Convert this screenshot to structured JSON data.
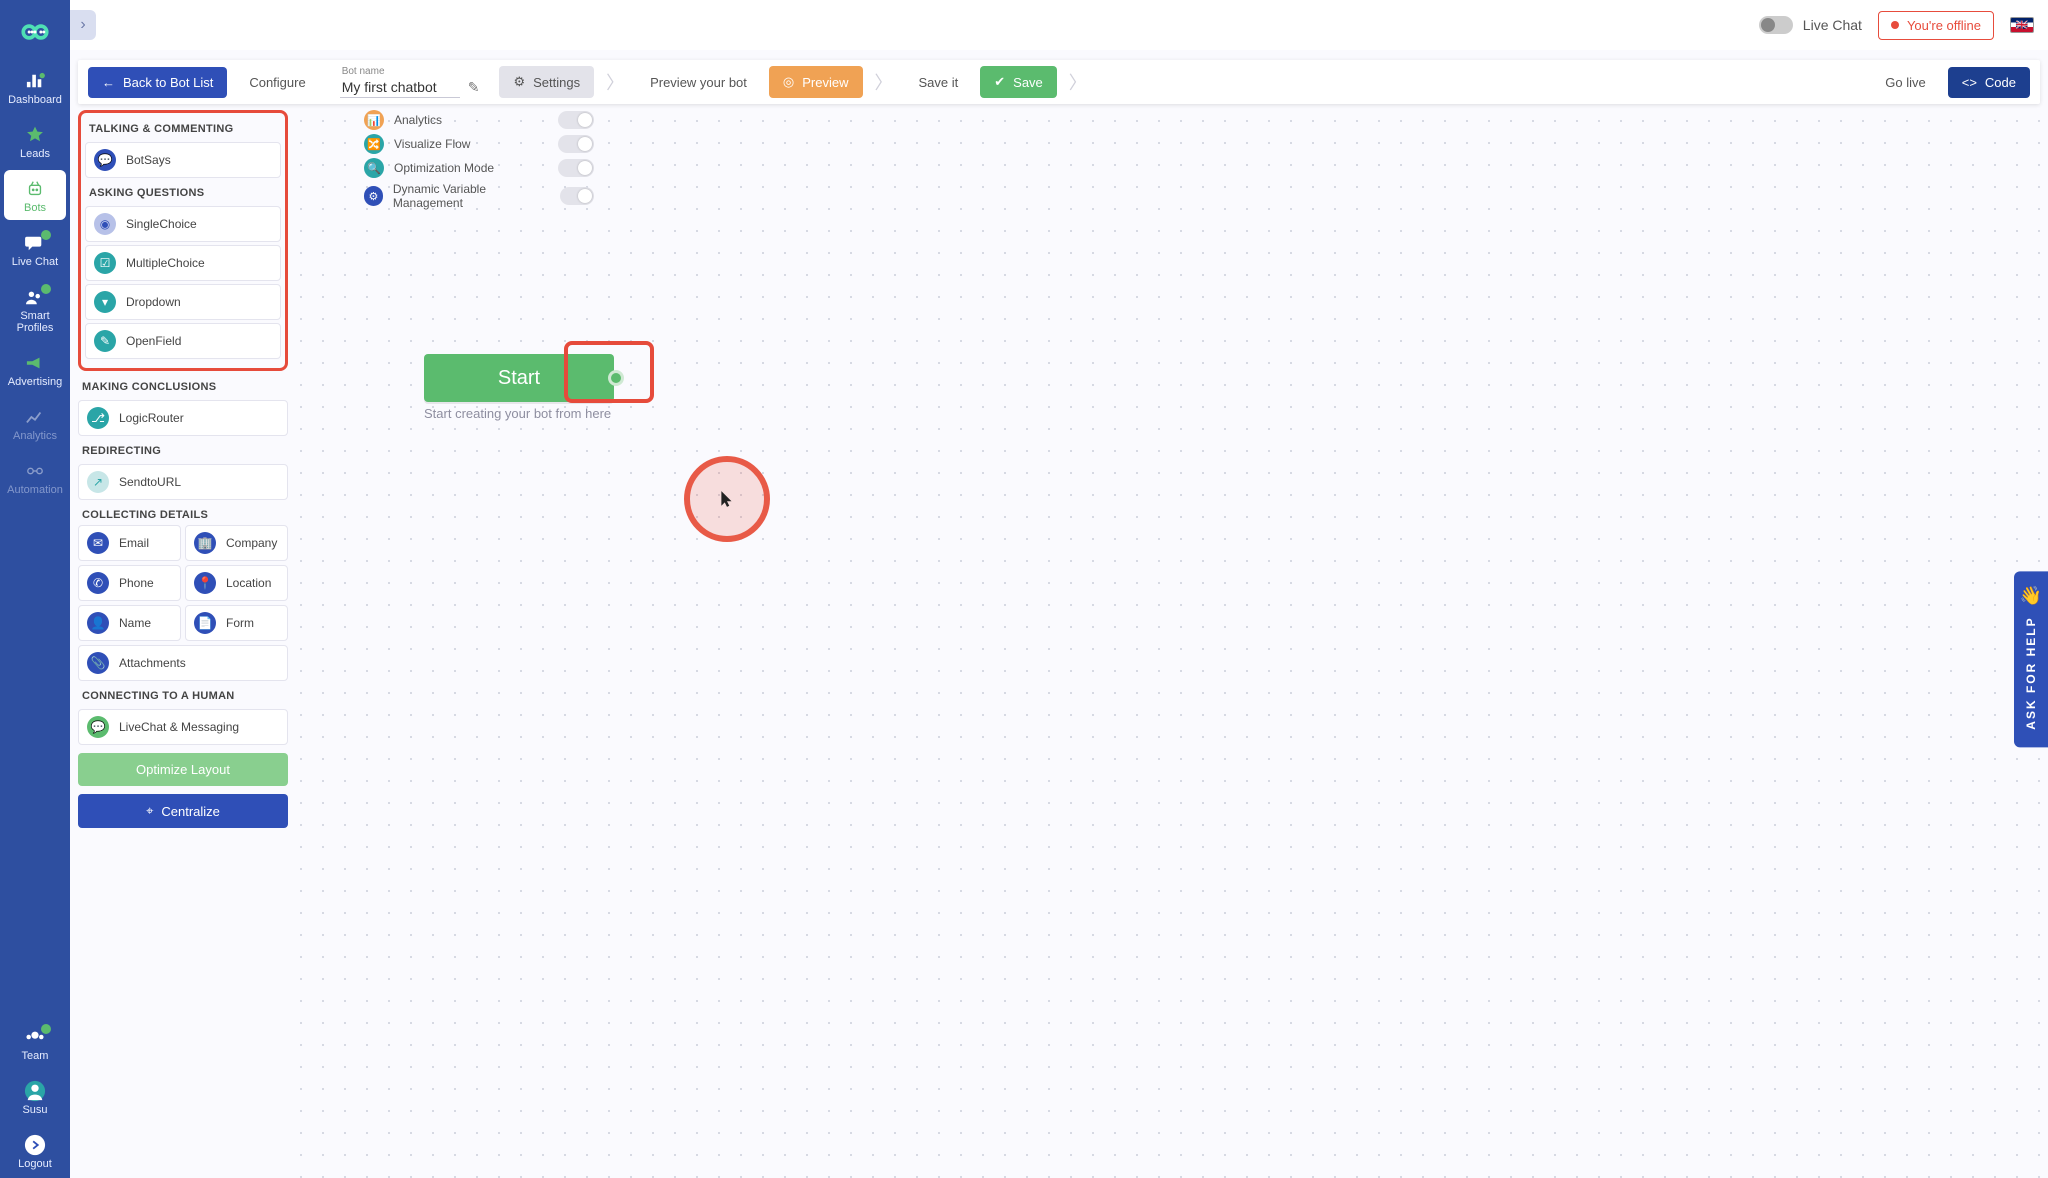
{
  "topbar": {
    "livechat_label": "Live Chat",
    "offline_label": "You're offline"
  },
  "toolbar": {
    "back_label": "Back to Bot List",
    "configure_label": "Configure",
    "botname_caption": "Bot name",
    "botname_value": "My first chatbot",
    "settings_label": "Settings",
    "preview_bot_label": "Preview your bot",
    "preview_btn": "Preview",
    "saveit_label": "Save it",
    "save_btn": "Save",
    "golive_label": "Go live",
    "code_btn": "Code"
  },
  "leftnav": [
    {
      "id": "dashboard",
      "label": "Dashboard"
    },
    {
      "id": "leads",
      "label": "Leads"
    },
    {
      "id": "bots",
      "label": "Bots"
    },
    {
      "id": "livechat",
      "label": "Live Chat"
    },
    {
      "id": "smartprofiles",
      "label": "Smart Profiles"
    },
    {
      "id": "advertising",
      "label": "Advertising"
    },
    {
      "id": "analytics",
      "label": "Analytics"
    },
    {
      "id": "automation",
      "label": "Automation"
    },
    {
      "id": "team",
      "label": "Team"
    },
    {
      "id": "user",
      "label": "Susu"
    },
    {
      "id": "logout",
      "label": "Logout"
    }
  ],
  "components": {
    "sections": {
      "talking": "TALKING & COMMENTING",
      "asking": "ASKING QUESTIONS",
      "making": "MAKING CONCLUSIONS",
      "redirecting": "REDIRECTING",
      "collecting": "COLLECTING DETAILS",
      "connecting": "CONNECTING TO A HUMAN"
    },
    "talking_items": [
      "BotSays"
    ],
    "asking_items": [
      "SingleChoice",
      "MultipleChoice",
      "Dropdown",
      "OpenField"
    ],
    "making_items": [
      "LogicRouter"
    ],
    "redirecting_items": [
      "SendtoURL"
    ],
    "collecting_items": [
      "Email",
      "Company",
      "Phone",
      "Location",
      "Name",
      "Form",
      "Attachments"
    ],
    "connecting_items": [
      "LiveChat & Messaging"
    ],
    "optimize_btn": "Optimize Layout",
    "centralize_btn": "Centralize"
  },
  "canvas": {
    "toggles": [
      "Analytics",
      "Visualize Flow",
      "Optimization Mode",
      "Dynamic Variable Management"
    ],
    "start_label": "Start",
    "start_hint": "Start creating your bot from here"
  },
  "askhelp": {
    "label": "ASK FOR HELP"
  }
}
